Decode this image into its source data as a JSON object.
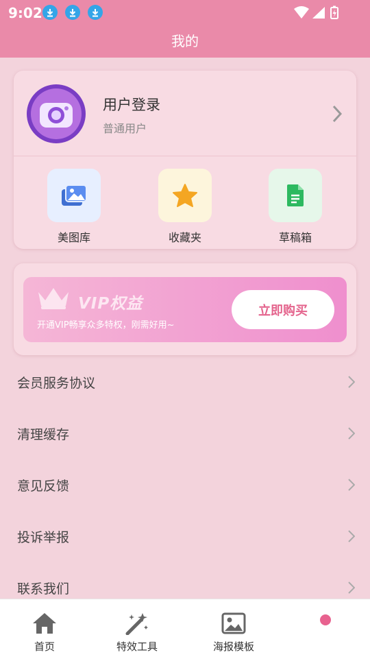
{
  "status_bar": {
    "time": "9:02"
  },
  "header": {
    "title": "我的"
  },
  "profile": {
    "name": "用户登录",
    "level": "普通用户"
  },
  "quick_actions": [
    {
      "label": "美图库",
      "icon": "gallery-icon",
      "bg": "#e7efff"
    },
    {
      "label": "收藏夹",
      "icon": "star-icon",
      "bg": "#fdf5dc"
    },
    {
      "label": "草稿箱",
      "icon": "document-icon",
      "bg": "#e6f7ea"
    }
  ],
  "vip": {
    "title": "VIP权益",
    "description": "开通VIP畅享众多特权，刚需好用~",
    "button": "立即购买"
  },
  "menu": [
    "会员服务协议",
    "清理缓存",
    "意见反馈",
    "投诉举报",
    "联系我们"
  ],
  "tabs": [
    {
      "label": "首页",
      "icon": "home-icon"
    },
    {
      "label": "特效工具",
      "icon": "magic-wand-icon"
    },
    {
      "label": "海报模板",
      "icon": "image-icon"
    },
    {
      "label": "",
      "icon": "profile-icon"
    }
  ],
  "colors": {
    "accent": "#ea8aa9",
    "background": "#f3d3dc"
  }
}
